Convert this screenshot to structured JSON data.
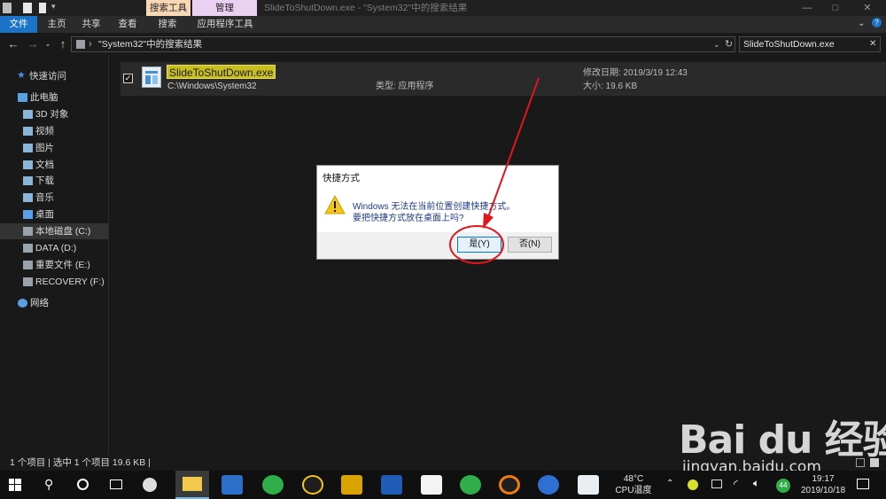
{
  "window": {
    "context_tabs": [
      "搜索工具",
      "管理"
    ],
    "title": "SlideToShutDown.exe - \"System32\"中的搜索结果",
    "controls": [
      "—",
      "□",
      "✕"
    ]
  },
  "ribbon": {
    "tabs": [
      "文件",
      "主页",
      "共享",
      "查看",
      "搜索",
      "应用程序工具"
    ]
  },
  "address": {
    "breadcrumb": "\"System32\"中的搜索结果",
    "search_value": "SlideToShutDown.exe"
  },
  "sidebar": {
    "items": [
      {
        "label": "快速访问",
        "icon": "star-icon"
      },
      {
        "label": "此电脑",
        "icon": "computer-icon"
      },
      {
        "label": "3D 对象",
        "icon": "folder-3d-icon"
      },
      {
        "label": "视频",
        "icon": "folder-video-icon"
      },
      {
        "label": "图片",
        "icon": "folder-pictures-icon"
      },
      {
        "label": "文档",
        "icon": "folder-documents-icon"
      },
      {
        "label": "下载",
        "icon": "folder-downloads-icon"
      },
      {
        "label": "音乐",
        "icon": "folder-music-icon"
      },
      {
        "label": "桌面",
        "icon": "folder-desktop-icon"
      },
      {
        "label": "本地磁盘 (C:)",
        "icon": "drive-icon"
      },
      {
        "label": "DATA (D:)",
        "icon": "drive-icon"
      },
      {
        "label": "重要文件 (E:)",
        "icon": "drive-icon"
      },
      {
        "label": "RECOVERY (F:)",
        "icon": "drive-icon"
      },
      {
        "label": "网络",
        "icon": "network-icon"
      }
    ]
  },
  "result": {
    "name": "SlideToShutDown.exe",
    "path": "C:\\Windows\\System32",
    "type": "类型: 应用程序",
    "modified": "修改日期: 2019/3/19 12:43",
    "size": "大小: 19.6 KB"
  },
  "dialog": {
    "title": "快捷方式",
    "message_line1": "Windows 无法在当前位置创建快捷方式。",
    "message_line2": "要把快捷方式放在桌面上吗?",
    "yes_label": "是(Y)",
    "no_label": "否(N)"
  },
  "status": {
    "text": "1 个项目  |  选中 1 个项目  19.6 KB  |"
  },
  "watermark": {
    "logo": "Bai du 经验",
    "url": "jingyan.baidu.com"
  },
  "taskbar": {
    "cpu_temp": "48°C",
    "cpu_label": "CPU温度",
    "badge": "44",
    "time": "19:17",
    "date": "2019/10/18"
  },
  "colors": {
    "accent": "#1b74c8",
    "annotation": "#e0161d",
    "highlight": "#c9c020"
  }
}
